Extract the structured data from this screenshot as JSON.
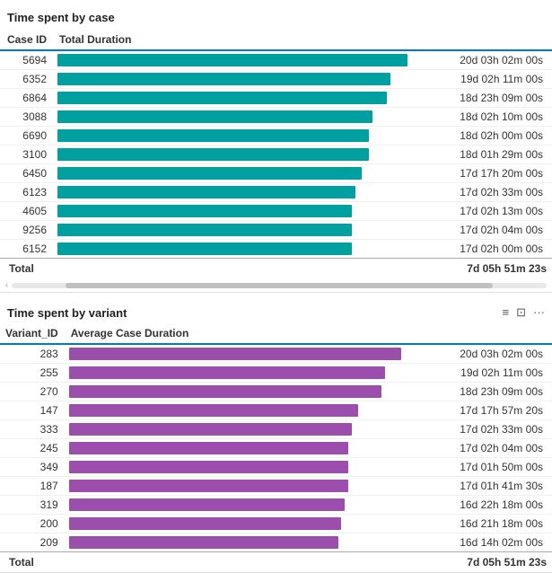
{
  "section1": {
    "title": "Time spent by case",
    "col1": "Case ID",
    "col2": "Total Duration",
    "rows": [
      {
        "id": "5694",
        "duration": "20d 03h 02m 00s",
        "pct": 100
      },
      {
        "id": "6352",
        "duration": "19d 02h 11m 00s",
        "pct": 95
      },
      {
        "id": "6864",
        "duration": "18d 23h 09m 00s",
        "pct": 94
      },
      {
        "id": "3088",
        "duration": "18d 02h 10m 00s",
        "pct": 90
      },
      {
        "id": "6690",
        "duration": "18d 02h 00m 00s",
        "pct": 89
      },
      {
        "id": "3100",
        "duration": "18d 01h 29m 00s",
        "pct": 89
      },
      {
        "id": "6450",
        "duration": "17d 17h 20m 00s",
        "pct": 87
      },
      {
        "id": "6123",
        "duration": "17d 02h 33m 00s",
        "pct": 85
      },
      {
        "id": "4605",
        "duration": "17d 02h 13m 00s",
        "pct": 84
      },
      {
        "id": "9256",
        "duration": "17d 02h 04m 00s",
        "pct": 84
      },
      {
        "id": "6152",
        "duration": "17d 02h 00m 00s",
        "pct": 84
      }
    ],
    "total_label": "Total",
    "total_duration": "7d 05h 51m 23s"
  },
  "section2": {
    "title": "Time spent by variant",
    "col1": "Variant_ID",
    "col2": "Average Case Duration",
    "rows": [
      {
        "id": "283",
        "duration": "20d 03h 02m 00s",
        "pct": 100
      },
      {
        "id": "255",
        "duration": "19d 02h 11m 00s",
        "pct": 95
      },
      {
        "id": "270",
        "duration": "18d 23h 09m 00s",
        "pct": 94
      },
      {
        "id": "147",
        "duration": "17d 17h 57m 20s",
        "pct": 87
      },
      {
        "id": "333",
        "duration": "17d 02h 33m 00s",
        "pct": 85
      },
      {
        "id": "245",
        "duration": "17d 02h 04m 00s",
        "pct": 84
      },
      {
        "id": "349",
        "duration": "17d 01h 50m 00s",
        "pct": 84
      },
      {
        "id": "187",
        "duration": "17d 01h 41m 30s",
        "pct": 84
      },
      {
        "id": "319",
        "duration": "16d 22h 18m 00s",
        "pct": 83
      },
      {
        "id": "200",
        "duration": "16d 21h 18m 00s",
        "pct": 82
      },
      {
        "id": "209",
        "duration": "16d 14h 02m 00s",
        "pct": 81
      }
    ],
    "total_label": "Total",
    "total_duration": "7d 05h 51m 23s"
  },
  "icons": {
    "filter": "≡",
    "expand": "⊡",
    "more": "···",
    "up": "∧",
    "down": "∨"
  }
}
